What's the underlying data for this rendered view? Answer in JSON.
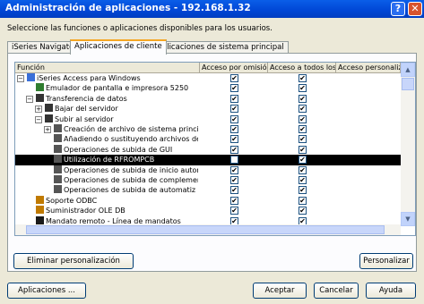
{
  "window": {
    "title": "Administración de aplicaciones - 192.168.1.32",
    "help_glyph": "?",
    "close_glyph": "✕"
  },
  "instruction": "Seleccione las funciones o aplicaciones disponibles para los usuarios.",
  "tabs": [
    {
      "label": "iSeries Navigator",
      "active": false
    },
    {
      "label": "Aplicaciones de cliente",
      "active": true
    },
    {
      "label": "Aplicaciones de sistema principal",
      "active": false
    }
  ],
  "table": {
    "columns": [
      "Función",
      "Acceso por omisión",
      "Acceso a todos los o",
      "Acceso personalizad"
    ],
    "rows": [
      {
        "label": "iSeries Access para Windows",
        "icon": "computer-icon",
        "default": true,
        "all": true
      },
      {
        "label": "Emulador de pantalla e impresora 5250",
        "icon": "terminal-icon",
        "default": true,
        "all": true
      },
      {
        "label": "Transferencia de datos",
        "icon": "folder-icon",
        "default": true,
        "all": true
      },
      {
        "label": "Bajar del servidor",
        "icon": "folder-icon",
        "default": true,
        "all": true
      },
      {
        "label": "Subir al servidor",
        "icon": "folder-icon",
        "default": true,
        "all": true
      },
      {
        "label": "Creación de archivo de sistema princip",
        "icon": "file-icon",
        "default": true,
        "all": true
      },
      {
        "label": "Añadiendo o sustituyendo archivos de",
        "icon": "file-icon",
        "default": true,
        "all": true
      },
      {
        "label": "Operaciones de subida de GUI",
        "icon": "file-icon",
        "default": true,
        "all": true
      },
      {
        "label": "Utilización de RFROMPCB",
        "icon": "file-icon",
        "default": false,
        "all": true
      },
      {
        "label": "Operaciones de subida de inicio autor",
        "icon": "file-icon",
        "default": true,
        "all": true
      },
      {
        "label": "Operaciones de subida de complemer",
        "icon": "file-icon",
        "default": true,
        "all": true
      },
      {
        "label": "Operaciones de subida de automatiz",
        "icon": "file-icon",
        "default": true,
        "all": true
      },
      {
        "label": "Soporte ODBC",
        "icon": "database-icon",
        "default": true,
        "all": true
      },
      {
        "label": "Suministrador OLE DB",
        "icon": "database-icon",
        "default": true,
        "all": true
      },
      {
        "label": "Mandato remoto - Línea de mandatos",
        "icon": "command-icon",
        "default": true,
        "all": true
      }
    ]
  },
  "buttons": {
    "remove_custom": "Eliminar personalización",
    "customize": "Personalizar",
    "applications": "Aplicaciones ...",
    "accept": "Aceptar",
    "cancel": "Cancelar",
    "help": "Ayuda"
  },
  "colors": {
    "title_bar": "#0046d5",
    "selected_row": "#000000",
    "tab_highlight": "#f5a623"
  }
}
